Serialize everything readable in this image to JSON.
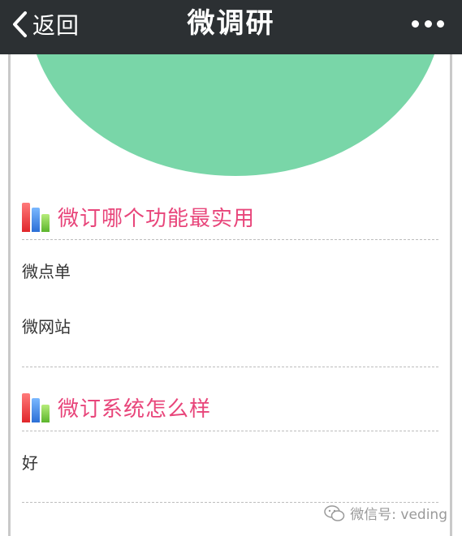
{
  "topbar": {
    "back_label": "返回",
    "title": "微调研"
  },
  "sections": [
    {
      "title": "微订哪个功能最实用",
      "options": [
        "微点单",
        "微网站"
      ]
    },
    {
      "title": "微订系统怎么样",
      "options": [
        "好"
      ]
    }
  ],
  "watermark": "微信号: veding",
  "colors": {
    "header": "#2c3033",
    "hero": "#79d6a8",
    "accent": "#e8457a"
  }
}
